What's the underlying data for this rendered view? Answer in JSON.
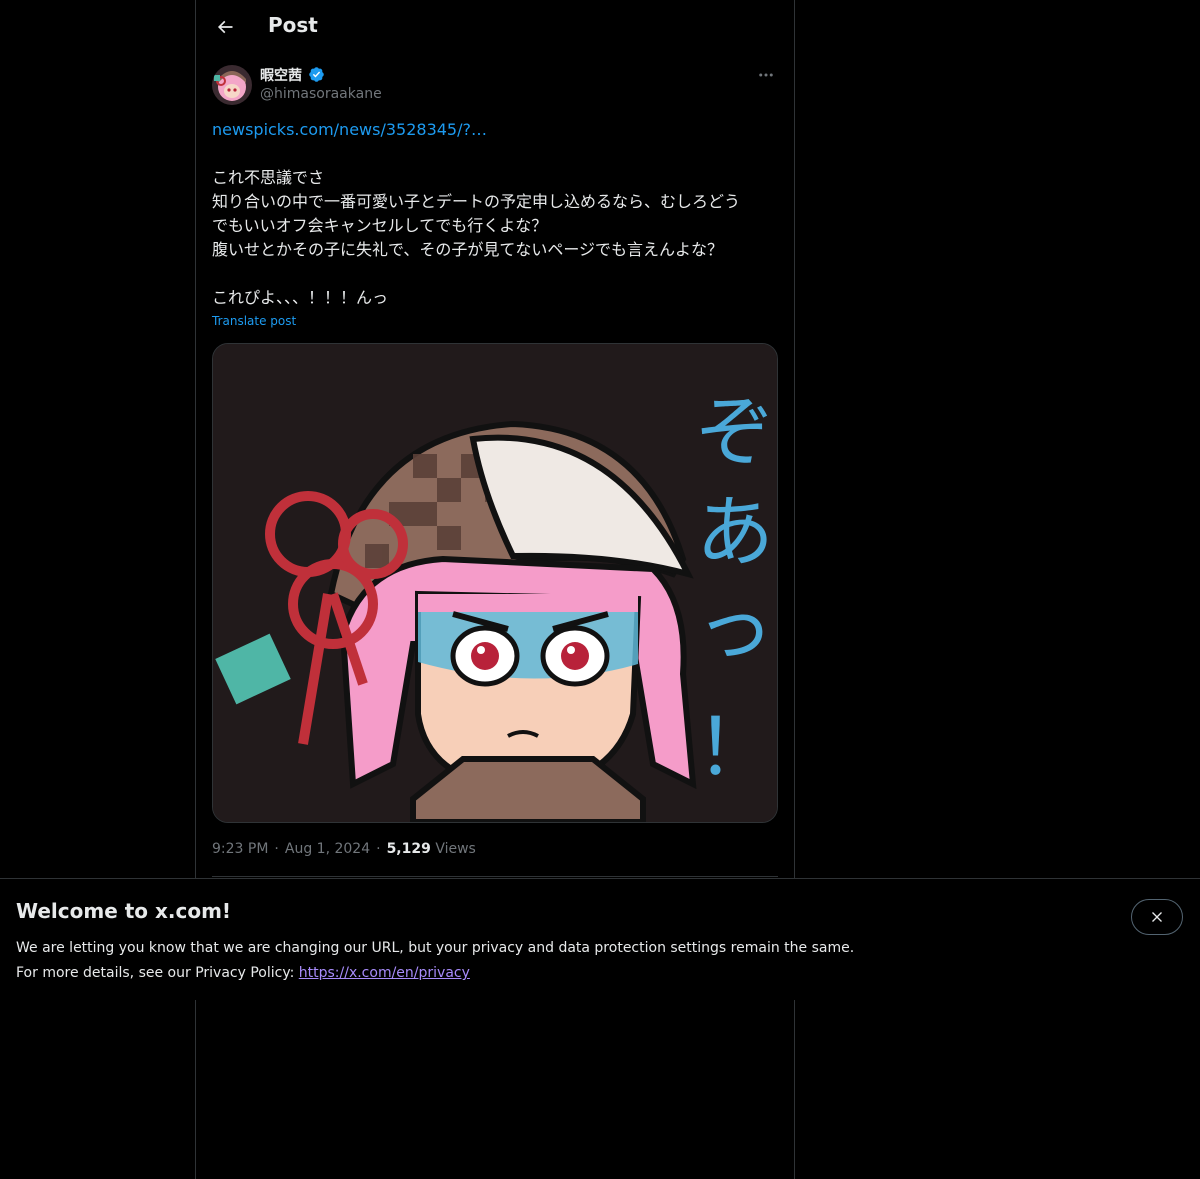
{
  "header": {
    "title": "Post",
    "back_icon": "arrow-left-icon"
  },
  "author": {
    "display_name": "暇空茜",
    "handle": "@himasoraakane",
    "verified": true,
    "verified_color": "#1d9bf0"
  },
  "post": {
    "link_text": "newspicks.com/news/3528345/?…",
    "lines": [
      "これ不思議でさ",
      "知り合いの中で一番可愛い子とデートの予定申し込めるなら、むしろどう",
      "でもいいオフ会キャンセルしてでも行くよな？",
      "腹いせとかその子に失礼で、その子が見てないページでも言えんよな？",
      "これぴよ、、、！！！んっ"
    ],
    "translate_label": "Translate post",
    "media": {
      "kind": "illustration",
      "caption_glyphs": [
        "ぞ",
        "あ",
        "っ",
        "！"
      ]
    },
    "time": "9:23 PM",
    "date": "Aug 1, 2024",
    "views_count": "5,129",
    "views_label": "Views",
    "separator": "·"
  },
  "banner": {
    "title": "Welcome to x.com!",
    "line1": "We are letting you know that we are changing our URL, but your privacy and data protection settings remain the same.",
    "line2_prefix": "For more details, see our Privacy Policy: ",
    "link_text": "https://x.com/en/privacy",
    "close_icon": "close-icon"
  },
  "colors": {
    "background": "#000000",
    "text": "#e7e9ea",
    "muted": "#71767b",
    "accent": "#1d9bf0",
    "border": "#2f3336",
    "banner_link": "#a78bfa"
  }
}
